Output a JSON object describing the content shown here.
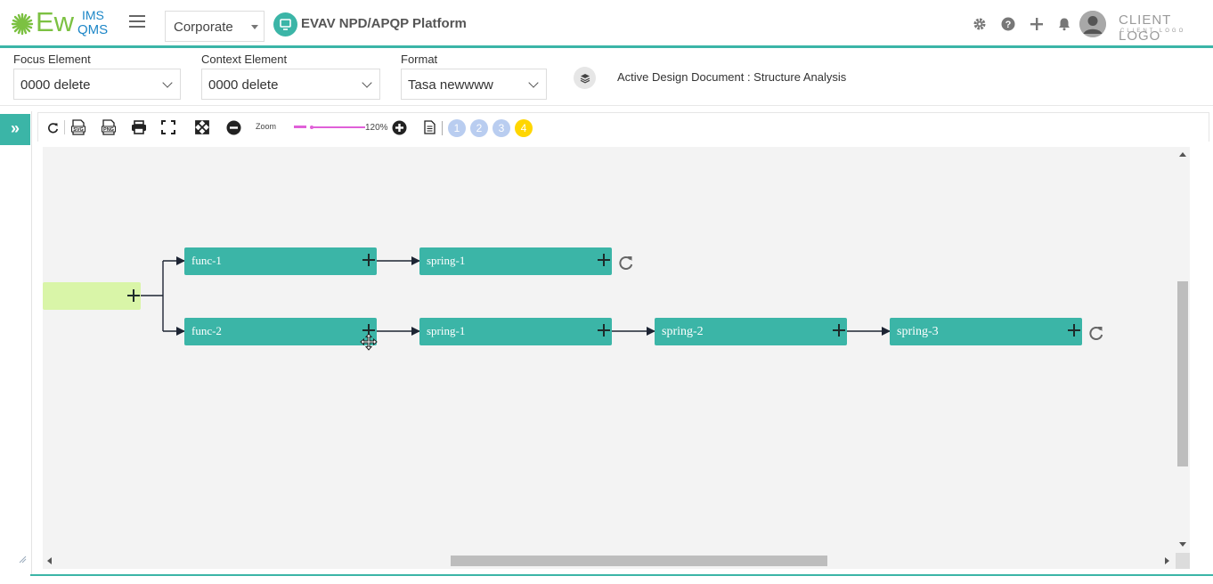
{
  "header": {
    "logo": {
      "main": "Ew",
      "sup": "IMS",
      "sub": "QMS"
    },
    "site_selector": {
      "value": "Corporate"
    },
    "platform_title": "EVAV NPD/APQP Platform",
    "icons": [
      "gear-icon",
      "help-icon",
      "plus-icon",
      "bell-icon"
    ],
    "client_logo": {
      "big": "CLIENT LOGO",
      "small": "CLIENT LOGO"
    }
  },
  "filters": {
    "focus": {
      "label": "Focus Element",
      "value": "0000 delete"
    },
    "context": {
      "label": "Context Element",
      "value": "0000 delete"
    },
    "format": {
      "label": "Format",
      "value": "Tasa newwww"
    },
    "active_doc": "Active Design Document : Structure Analysis"
  },
  "toolbar": {
    "buttons": [
      "refresh-icon",
      "svg-export-icon",
      "png-export-icon",
      "print-icon",
      "fullscreen-icon",
      "fit-icon",
      "zoom-out-icon"
    ],
    "zoom_label": "Zoom",
    "zoom_value": "120%",
    "zoom_fraction": 0.2,
    "steps": [
      "1",
      "2",
      "3",
      "4"
    ],
    "active_step": "4"
  },
  "diagram": {
    "root": {
      "label": ""
    },
    "rows": [
      {
        "nodes": [
          "func-1",
          "spring-1"
        ]
      },
      {
        "nodes": [
          "func-2",
          "spring-1",
          "spring-2",
          "spring-3"
        ]
      }
    ]
  },
  "colors": {
    "accent": "#3bb5a7",
    "root_node": "#d9f5a8",
    "canvas": "#f3f3f3",
    "active_step": "#ffd600",
    "step": "#b9cdf0",
    "zoom": "#e060d8"
  }
}
